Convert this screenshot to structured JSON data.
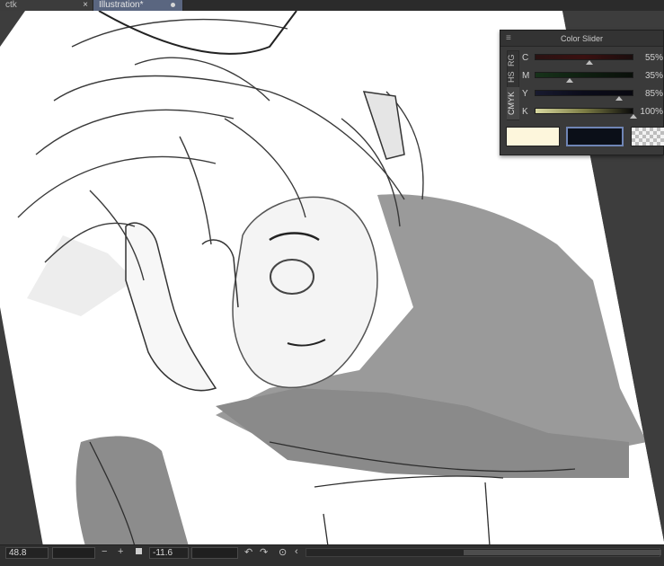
{
  "tabs": [
    {
      "label": "ctk",
      "close": "×"
    },
    {
      "label": "Illustration*"
    }
  ],
  "color_slider": {
    "title": "Color Slider",
    "menu_glyph": "≡",
    "modes": [
      "RG",
      "HS",
      "CMYK"
    ],
    "active_mode": "CMYK",
    "sliders": [
      {
        "label": "C",
        "value": "55%",
        "level": 0.55,
        "gradient": [
          "#2a1212",
          "#3a1010",
          "#1b0e0e"
        ]
      },
      {
        "label": "M",
        "value": "35%",
        "level": 0.35,
        "gradient": [
          "#17321a",
          "#0e1f10",
          "#0a0f0a"
        ]
      },
      {
        "label": "Y",
        "value": "85%",
        "level": 0.85,
        "gradient": [
          "#181a2e",
          "#0b0c1a",
          "#080810"
        ]
      },
      {
        "label": "K",
        "value": "100%",
        "level": 1.0,
        "gradient": [
          "#d8d8a0",
          "#7d7d45",
          "#0a0a0a"
        ]
      }
    ],
    "swatches": {
      "main_color": "#fdf6dc",
      "sub_color": "#0b0f18",
      "transparent_label": ""
    }
  },
  "statusbar": {
    "zoom": "48.8",
    "angle": "-11.6",
    "minus": "−",
    "plus": "+",
    "rotate_left": "↶",
    "rotate_right": "↷",
    "reset": "⊙",
    "arrow": "‹"
  },
  "colors": {
    "background": "#3b3b3b",
    "paper": "#ffffff",
    "active_tab": "#5a6680",
    "sub_color_border": "#6f85b5"
  },
  "icons": {
    "tab_close": "close-icon",
    "panel_menu": "menu-icon",
    "rotate_left": "rotate-left-icon",
    "rotate_right": "rotate-right-icon",
    "reset": "reset-rotation-icon"
  }
}
